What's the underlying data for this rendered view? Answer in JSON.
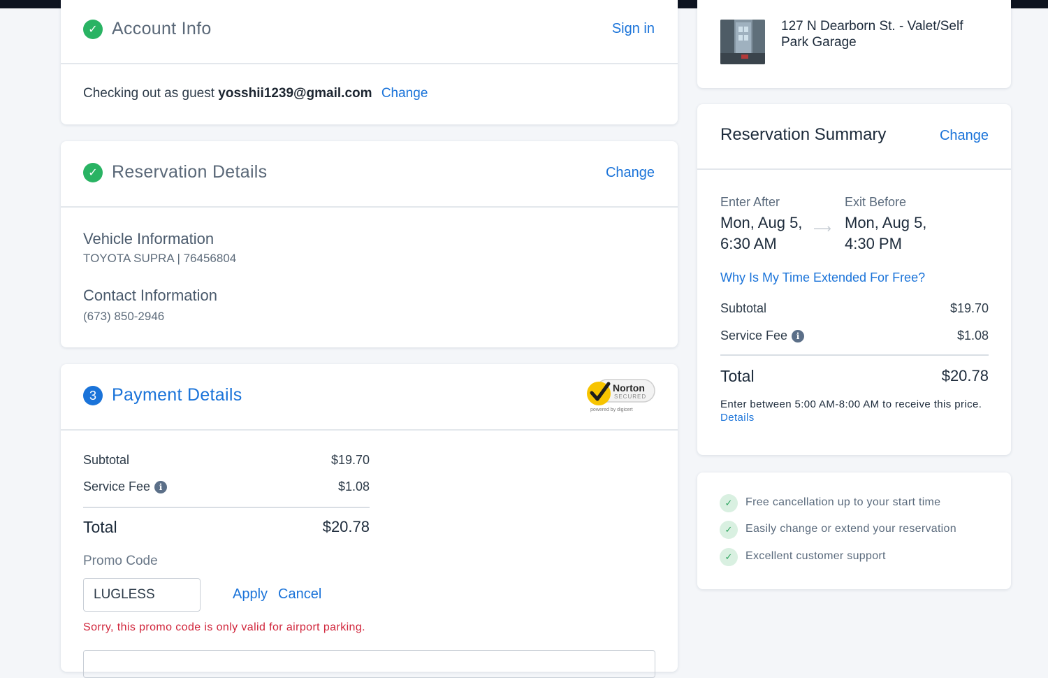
{
  "account": {
    "title": "Account Info",
    "sign_in": "Sign in",
    "guest_prefix": "Checking out as guest",
    "guest_email": "yosshii1239@gmail.com",
    "change": "Change"
  },
  "reservation_details": {
    "title": "Reservation Details",
    "change": "Change",
    "vehicle_heading": "Vehicle Information",
    "vehicle_value": "TOYOTA SUPRA | 76456804",
    "contact_heading": "Contact Information",
    "contact_value": "(673) 850-2946"
  },
  "payment": {
    "step_number": "3",
    "title": "Payment Details",
    "norton_label": "Norton",
    "norton_sub": "SECURED",
    "norton_powered": "powered by digicert",
    "subtotal_label": "Subtotal",
    "subtotal_value": "$19.70",
    "fee_label": "Service Fee",
    "fee_value": "$1.08",
    "total_label": "Total",
    "total_value": "$20.78",
    "promo_label": "Promo Code",
    "promo_value": "LUGLESS",
    "apply": "Apply",
    "cancel": "Cancel",
    "promo_error": "Sorry, this promo code is only valid for airport parking."
  },
  "location": {
    "name": "127 N Dearborn St. - Valet/Self Park Garage"
  },
  "summary": {
    "title": "Reservation Summary",
    "change": "Change",
    "enter_label": "Enter After",
    "enter_date": "Mon, Aug 5,",
    "enter_time": "6:30 AM",
    "exit_label": "Exit Before",
    "exit_date": "Mon, Aug 5,",
    "exit_time": "4:30 PM",
    "why_link": "Why Is My Time Extended For Free?",
    "subtotal_label": "Subtotal",
    "subtotal_value": "$19.70",
    "fee_label": "Service Fee",
    "fee_value": "$1.08",
    "total_label": "Total",
    "total_value": "$20.78",
    "note": "Enter between 5:00 AM-8:00 AM to receive this price.",
    "details_link": "Details"
  },
  "benefits": [
    "Free cancellation up to your start time",
    "Easily change or extend your reservation",
    "Excellent customer support"
  ],
  "colors": {
    "accent": "#1a73d9",
    "success": "#29b363",
    "error": "#d0243a"
  }
}
